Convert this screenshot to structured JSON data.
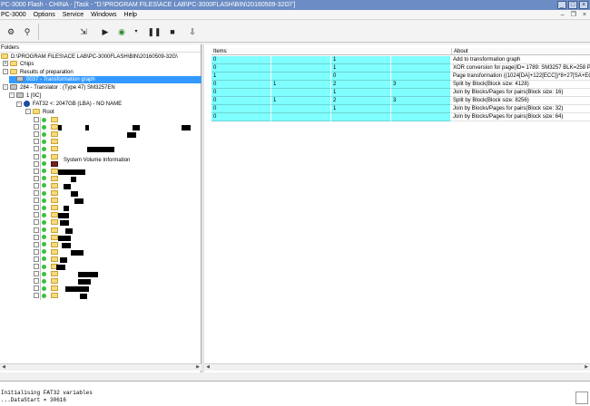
{
  "app": {
    "title": "PC-3000 Flash - CHINA - [Task - \"D:\\PROGRAM FILES\\ACE LAB\\PC-3000FLASH\\BIN\\20160509-32G\\\"]"
  },
  "menu": [
    "PC-3000",
    "Options",
    "Service",
    "Windows",
    "Help"
  ],
  "tree": {
    "header": "Folders",
    "root": "D:\\PROGRAM FILES\\ACE LAB\\PC-3000FLASH\\BIN\\20160509-32G\\",
    "chips": "Chips",
    "results": "Results of preparation",
    "graph": "0037 - Transformation graph",
    "translator": "284 - Translator : (Type 47) SM3257EN",
    "node1": "1 [0C]",
    "fat": "FAT32 <: 2047GB (LBA) - NO NAME",
    "root_folder": "Root",
    "svi": "System Volume Information"
  },
  "grid": {
    "items_header": "Items",
    "about_header": "About",
    "rows": [
      {
        "c": [
          "0",
          "",
          "1",
          ""
        ],
        "about": "Add to transformation graph"
      },
      {
        "c": [
          "0",
          "",
          "1",
          ""
        ],
        "about": "XOR conversion for page(ID= 1789: SM3257 BLK=258 PG=5"
      },
      {
        "c": [
          "1",
          "",
          "0",
          ""
        ],
        "about": "Page transformation ((1024[DA]+122[ECC])*8+27[SA+ECC])"
      },
      {
        "c": [
          "0",
          "1",
          "2",
          "3"
        ],
        "about": "Split by Block(Block size: 4128)"
      },
      {
        "c": [
          "0",
          "",
          "1",
          ""
        ],
        "about": "Join by Blocks/Pages for pairs(Block size: 16)"
      },
      {
        "c": [
          "0",
          "1",
          "2",
          "3"
        ],
        "about": "Split by Block(Block size: 8256)"
      },
      {
        "c": [
          "0",
          "",
          "1",
          ""
        ],
        "about": "Join by Blocks/Pages for pairs(Block size: 32)"
      },
      {
        "c": [
          "0",
          "",
          "",
          ""
        ],
        "about": "Join by Blocks/Pages for pairs(Block size: 64)"
      }
    ]
  },
  "log": {
    "line1": "Initialising FAT32 variables",
    "line2": "...DataStart = 30616"
  },
  "colors": {
    "titlebar": "#6b8cc4",
    "selection": "#3399ff",
    "grid_cell": "#7fffff"
  }
}
